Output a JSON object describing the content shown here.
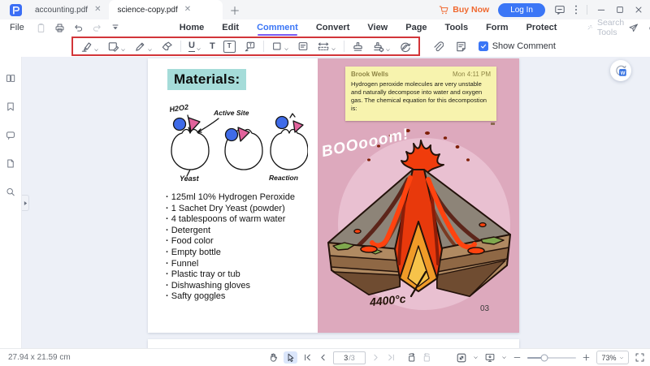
{
  "titlebar": {
    "tabs": [
      {
        "label": "accounting.pdf"
      },
      {
        "label": "science-copy.pdf"
      }
    ],
    "buy_now": "Buy Now",
    "log_in": "Log In"
  },
  "menubar": {
    "file": "File",
    "items": [
      "Home",
      "Edit",
      "Comment",
      "Convert",
      "View",
      "Page",
      "Tools",
      "Form",
      "Protect"
    ],
    "active_item": "Comment",
    "search_placeholder": "Search Tools"
  },
  "toolbar": {
    "show_comment": "Show Comment",
    "show_comment_checked": true,
    "tools": [
      "highlight",
      "area-highlight",
      "pencil",
      "eraser",
      "underline",
      "typewriter",
      "text-box",
      "callout",
      "shape",
      "sticky-note",
      "measure",
      "stamp",
      "custom-stamp",
      "signature",
      "attachment",
      "comment-list"
    ]
  },
  "sidebar": {
    "icons": [
      "thumbnails",
      "bookmarks",
      "comments",
      "attachments",
      "search"
    ]
  },
  "document": {
    "left_page": {
      "heading": "Materials:",
      "materials": [
        "125ml 10% Hydrogen Peroxide",
        "1 Sachet Dry Yeast (powder)",
        "4 tablespoons of warm water",
        "Detergent",
        "Food color",
        "Empty bottle",
        "Funnel",
        "Plastic tray or tub",
        "Dishwashing gloves",
        "Safty goggles"
      ],
      "diagram": {
        "h2o2": "H2O2",
        "active_site": "Active Site",
        "yeast": "Yeast",
        "reaction": "Reaction"
      }
    },
    "right_page": {
      "note": {
        "author": "Brook Wells",
        "time": "Mon 4:11 PM",
        "body": "Hydrogen peroxide molecules are very unstable and naturally decompose into water and oxygen gas. The chemical equation for this decompostion is:"
      },
      "boom": "BOOooom!",
      "temperature": "4400°c",
      "page_number": "03"
    }
  },
  "statusbar": {
    "page_size": "27.94 x 21.59 cm",
    "current_page": "3",
    "total_pages": "/3",
    "zoom_level": "73%"
  },
  "colors": {
    "accent": "#3b76f6",
    "highlight_box_red": "#d23539",
    "page_pink": "#dda9bd",
    "note_yellow": "#f7f3ae",
    "heading_teal": "#a5dcd9",
    "buy_now_orange": "#f0682f",
    "underline_purple": "#7a5af5"
  }
}
